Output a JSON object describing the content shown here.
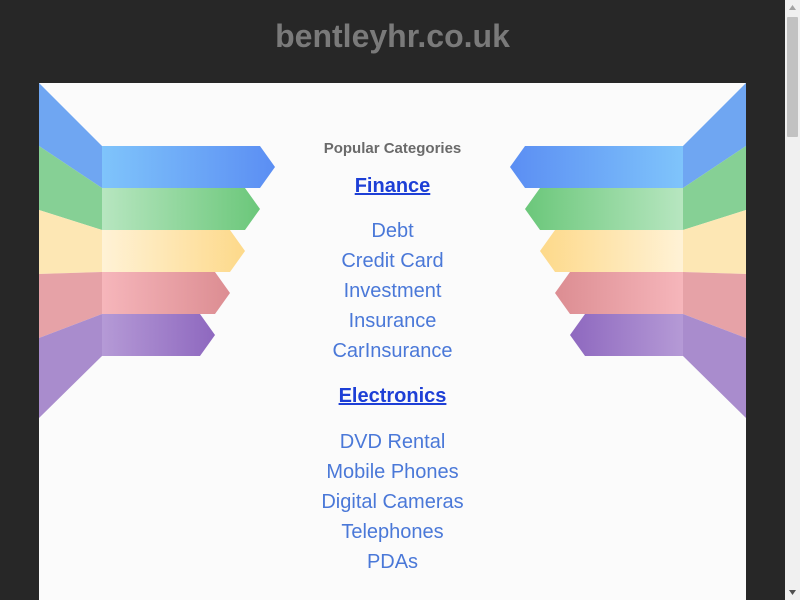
{
  "site": {
    "title": "bentleyhr.co.uk"
  },
  "categories": {
    "heading": "Popular Categories",
    "sections": [
      {
        "title": "Finance",
        "links": [
          "Debt",
          "Credit Card",
          "Investment",
          "Insurance",
          "CarInsurance"
        ]
      },
      {
        "title": "Electronics",
        "links": [
          "DVD Rental",
          "Mobile Phones",
          "Digital Cameras",
          "Telephones",
          "PDAs"
        ]
      }
    ]
  },
  "colors": {
    "background": "#272727",
    "panel": "#fbfbfb",
    "title": "#7a7a7a",
    "section_link": "#1d3fd6",
    "item_link": "#4a78d8",
    "ribbon_blue": "#5fa8f5",
    "ribbon_green": "#7dd08a",
    "ribbon_yellow": "#fde29a",
    "ribbon_red": "#e89aa0",
    "ribbon_purple": "#a07cc6"
  }
}
